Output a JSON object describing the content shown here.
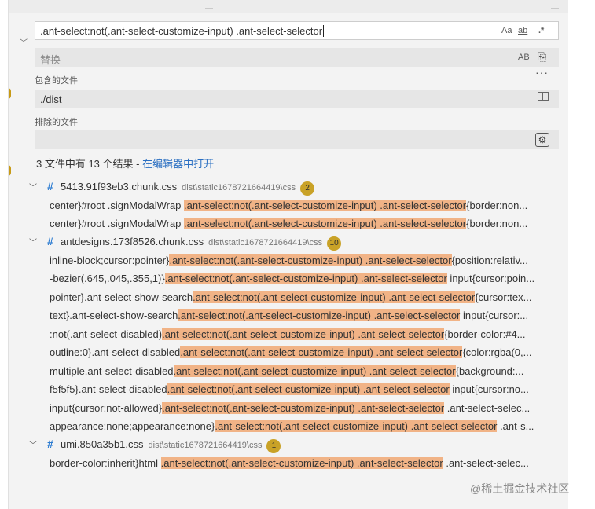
{
  "search": {
    "find_value": ".ant-select:not(.ant-select-customize-input) .ant-select-selector",
    "match_case_label": "Aa",
    "whole_word_label": "ab",
    "regex_label": ".*",
    "replace_placeholder": "替换",
    "preserve_case_label": "AB",
    "replace_all_icon": "replace-all-icon",
    "include_label": "包含的文件",
    "include_value": "./dist",
    "exclude_label": "排除的文件",
    "exclude_value": ""
  },
  "summary": {
    "text": "3 文件中有 13 个结果 - ",
    "link": "在编辑器中打开"
  },
  "groups": [
    {
      "file": "5413.91f93eb3.chunk.css",
      "path": "dist\\static1678721664419\\css",
      "count": "2",
      "matches": [
        {
          "before": "center}#root .signModalWrap ",
          "match": ".ant-select:not(.ant-select-customize-input) .ant-select-selector",
          "after": "{border:non..."
        },
        {
          "before": "center}#root .signModalWrap ",
          "match": ".ant-select:not(.ant-select-customize-input) .ant-select-selector",
          "after": "{border:non..."
        }
      ]
    },
    {
      "file": "antdesigns.173f8526.chunk.css",
      "path": "dist\\static1678721664419\\css",
      "count": "10",
      "matches": [
        {
          "before": "inline-block;cursor:pointer}",
          "match": ".ant-select:not(.ant-select-customize-input) .ant-select-selector",
          "after": "{position:relativ..."
        },
        {
          "before": "-bezier(.645,.045,.355,1)}",
          "match": ".ant-select:not(.ant-select-customize-input) .ant-select-selector",
          "after": " input{cursor:poin..."
        },
        {
          "before": "pointer}.ant-select-show-search",
          "match": ".ant-select:not(.ant-select-customize-input) .ant-select-selector",
          "after": "{cursor:tex..."
        },
        {
          "before": "text}.ant-select-show-search",
          "match": ".ant-select:not(.ant-select-customize-input) .ant-select-selector",
          "after": " input{cursor:..."
        },
        {
          "before": ":not(.ant-select-disabled)",
          "match": ".ant-select:not(.ant-select-customize-input) .ant-select-selector",
          "after": "{border-color:#4..."
        },
        {
          "before": "outline:0}.ant-select-disabled",
          "match": ".ant-select:not(.ant-select-customize-input) .ant-select-selector",
          "after": "{color:rgba(0,..."
        },
        {
          "before": "multiple.ant-select-disabled",
          "match": ".ant-select:not(.ant-select-customize-input) .ant-select-selector",
          "after": "{background:..."
        },
        {
          "before": "f5f5f5}.ant-select-disabled",
          "match": ".ant-select:not(.ant-select-customize-input) .ant-select-selector",
          "after": " input{cursor:no..."
        },
        {
          "before": "input{cursor:not-allowed}",
          "match": ".ant-select:not(.ant-select-customize-input) .ant-select-selector",
          "after": " .ant-select-selec..."
        },
        {
          "before": "appearance:none;appearance:none}",
          "match": ".ant-select:not(.ant-select-customize-input) .ant-select-selector",
          "after": " .ant-s..."
        }
      ]
    },
    {
      "file": "umi.850a35b1.css",
      "path": "dist\\static1678721664419\\css",
      "count": "1",
      "matches": [
        {
          "before": "border-color:inherit}html ",
          "match": ".ant-select:not(.ant-select-customize-input) .ant-select-selector",
          "after": " .ant-select-selec..."
        }
      ]
    }
  ],
  "watermark": "@稀土掘金技术社区",
  "colors": {
    "match_highlight": "#f1b386",
    "badge": "#c9a227",
    "link": "#2a6fc2",
    "file_icon": "#2b7bd1"
  }
}
